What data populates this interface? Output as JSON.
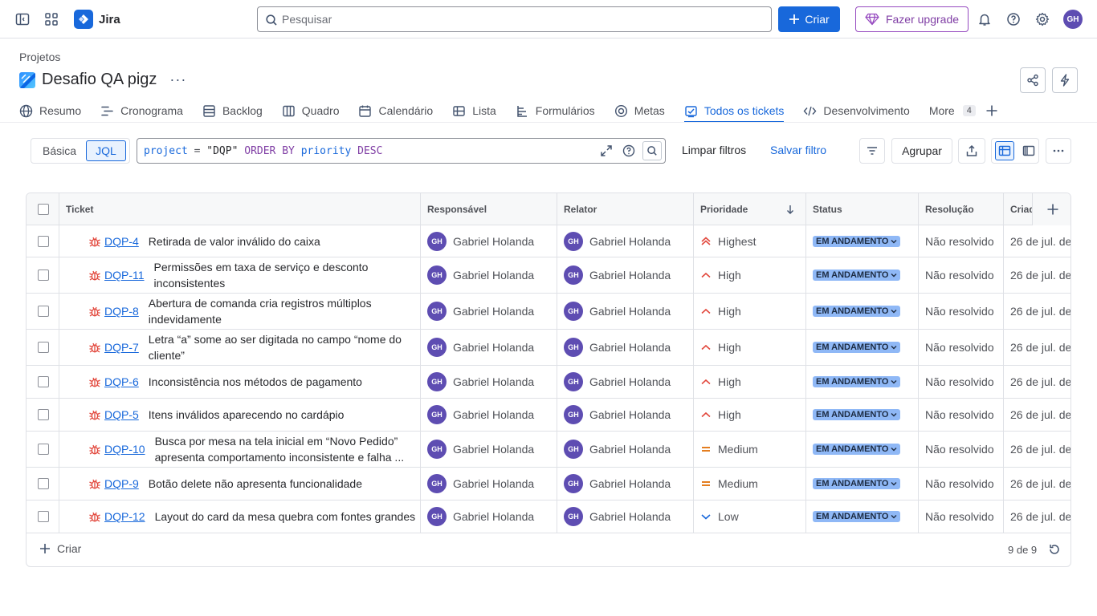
{
  "app": {
    "name": "Jira"
  },
  "search": {
    "placeholder": "Pesquisar"
  },
  "top_actions": {
    "create_label": "Criar",
    "upgrade_label": "Fazer upgrade",
    "avatar_initials": "GH"
  },
  "breadcrumb": "Projetos",
  "project": {
    "title": "Desafio QA pigz",
    "more": "···"
  },
  "tabs": [
    {
      "label": "Resumo"
    },
    {
      "label": "Cronograma"
    },
    {
      "label": "Backlog"
    },
    {
      "label": "Quadro"
    },
    {
      "label": "Calendário"
    },
    {
      "label": "Lista"
    },
    {
      "label": "Formulários"
    },
    {
      "label": "Metas"
    },
    {
      "label": "Todos os tickets",
      "active": true
    },
    {
      "label": "Desenvolvimento"
    },
    {
      "label": "More",
      "count": "4"
    }
  ],
  "filter": {
    "basic_label": "Básica",
    "jql_label": "JQL",
    "jql": {
      "t1": "project",
      "t2": " = ",
      "t3": "\"DQP\"",
      "t4": " ORDER BY ",
      "t5": "priority",
      "t6": " DESC"
    },
    "clear_label": "Limpar filtros",
    "save_label": "Salvar filtro",
    "group_label": "Agrupar"
  },
  "table": {
    "headers": {
      "ticket": "Ticket",
      "assignee": "Responsável",
      "reporter": "Relator",
      "priority": "Prioridade",
      "status": "Status",
      "resolution": "Resolução",
      "created": "Criad"
    },
    "rows": [
      {
        "key": "DQP-4",
        "summary": "Retirada de valor inválido do caixa",
        "assignee": "Gabriel Holanda",
        "reporter": "Gabriel Holanda",
        "priority": "Highest",
        "status": "EM ANDAMENTO",
        "resolution": "Não resolvido",
        "created": "26 de jul. de"
      },
      {
        "key": "DQP-11",
        "summary": "Permissões em taxa de serviço e desconto inconsistentes",
        "assignee": "Gabriel Holanda",
        "reporter": "Gabriel Holanda",
        "priority": "High",
        "status": "EM ANDAMENTO",
        "resolution": "Não resolvido",
        "created": "26 de jul. de"
      },
      {
        "key": "DQP-8",
        "summary": "Abertura de comanda cria registros múltiplos indevidamente",
        "assignee": "Gabriel Holanda",
        "reporter": "Gabriel Holanda",
        "priority": "High",
        "status": "EM ANDAMENTO",
        "resolution": "Não resolvido",
        "created": "26 de jul. de"
      },
      {
        "key": "DQP-7",
        "summary": "Letra “a” some ao ser digitada no campo “nome do cliente”",
        "assignee": "Gabriel Holanda",
        "reporter": "Gabriel Holanda",
        "priority": "High",
        "status": "EM ANDAMENTO",
        "resolution": "Não resolvido",
        "created": "26 de jul. de"
      },
      {
        "key": "DQP-6",
        "summary": "Inconsistência nos métodos de pagamento",
        "assignee": "Gabriel Holanda",
        "reporter": "Gabriel Holanda",
        "priority": "High",
        "status": "EM ANDAMENTO",
        "resolution": "Não resolvido",
        "created": "26 de jul. de"
      },
      {
        "key": "DQP-5",
        "summary": "Itens inválidos aparecendo no cardápio",
        "assignee": "Gabriel Holanda",
        "reporter": "Gabriel Holanda",
        "priority": "High",
        "status": "EM ANDAMENTO",
        "resolution": "Não resolvido",
        "created": "26 de jul. de"
      },
      {
        "key": "DQP-10",
        "summary": "Busca por mesa na tela inicial em “Novo Pedido” apresenta comportamento inconsistente e falha ...",
        "assignee": "Gabriel Holanda",
        "reporter": "Gabriel Holanda",
        "priority": "Medium",
        "status": "EM ANDAMENTO",
        "resolution": "Não resolvido",
        "created": "26 de jul. de"
      },
      {
        "key": "DQP-9",
        "summary": "Botão delete não apresenta funcionalidade",
        "assignee": "Gabriel Holanda",
        "reporter": "Gabriel Holanda",
        "priority": "Medium",
        "status": "EM ANDAMENTO",
        "resolution": "Não resolvido",
        "created": "26 de jul. de"
      },
      {
        "key": "DQP-12",
        "summary": "Layout do card da mesa quebra com fontes grandes",
        "assignee": "Gabriel Holanda",
        "reporter": "Gabriel Holanda",
        "priority": "Low",
        "status": "EM ANDAMENTO",
        "resolution": "Não resolvido",
        "created": "26 de jul. de"
      }
    ],
    "assignee_initials": "GH",
    "footer": {
      "create_label": "Criar",
      "count": "9 de 9"
    }
  },
  "colors": {
    "accent": "#1868db",
    "bug": "#e2483d",
    "priority_high": "#e2483d",
    "priority_medium": "#e06c00",
    "priority_low": "#1868db",
    "status_bg": "#8fb8f6",
    "avatar": "#5e4db2",
    "upgrade": "#964ac0"
  },
  "icons": {
    "sidebar_toggle": "sidebar-toggle-icon",
    "app_switcher": "app-switcher-icon",
    "notifications": "bell-icon",
    "help": "help-icon",
    "settings": "gear-icon",
    "bug": "bug-icon",
    "share": "share-icon",
    "automation": "lightning-icon"
  }
}
